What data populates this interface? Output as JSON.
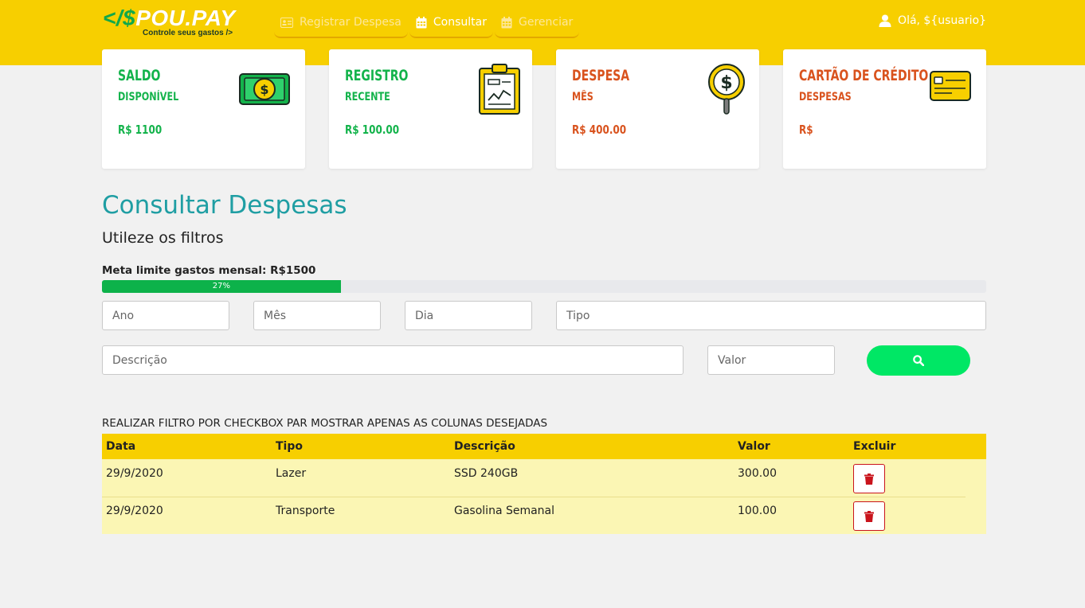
{
  "logo": {
    "code": "</$",
    "name": "POU.PAY",
    "tagline": "Controle seus gastos />"
  },
  "nav": {
    "items": [
      {
        "label": "Registrar Despesa",
        "icon": "id-card-icon"
      },
      {
        "label": "Consultar",
        "icon": "calendar-icon",
        "active": true
      },
      {
        "label": "Gerenciar",
        "icon": "calendar-icon"
      }
    ]
  },
  "user": {
    "greeting": "Olá, ${usuario}",
    "icon": "user-icon"
  },
  "cards": [
    {
      "title": "SALDO",
      "subtitle": "DISPONÍVEL",
      "value": "R$ 1100",
      "icon": "money-bill-icon"
    },
    {
      "title": "REGISTRO",
      "subtitle": "RECENTE",
      "value": "R$ 100.00",
      "icon": "clipboard-chart-icon"
    },
    {
      "title": "DESPESA",
      "subtitle": "MÊS",
      "value": "R$ 400.00",
      "icon": "magnifier-dollar-icon"
    },
    {
      "title": "CARTÃO DE CRÉDITO",
      "subtitle": "DESPESAS",
      "value": "R$",
      "icon": "credit-card-icon"
    }
  ],
  "main": {
    "title": "Consultar Despesas",
    "subtitle": "Utileze os filtros",
    "meta_label": "Meta limite gastos mensal: R$1500",
    "progress_percent": 27,
    "progress_label": "27%"
  },
  "filters": {
    "ano": "Ano",
    "mes": "Mês",
    "dia": "Dia",
    "tipo": "Tipo",
    "descricao": "Descrição",
    "valor": "Valor",
    "search_icon": "search-icon"
  },
  "filter_note": "REALIZAR FILTRO POR CHECKBOX PAR MOSTRAR APENAS AS COLUNAS DESEJADAS",
  "table": {
    "headers": [
      "Data",
      "Tipo",
      "Descrição",
      "Valor",
      "Excluir"
    ],
    "rows": [
      {
        "data": "29/9/2020",
        "tipo": "Lazer",
        "descricao": "SSD 240GB",
        "valor": "300.00"
      },
      {
        "data": "29/9/2020",
        "tipo": "Transporte",
        "descricao": "Gasolina Semanal",
        "valor": "100.00"
      }
    ]
  },
  "colors": {
    "header": "#f7cf00",
    "accent_green": "#13b34b",
    "accent_orange": "#d9531e",
    "title_teal": "#1f9ea3",
    "search_button": "#00e765",
    "row_bg": "#fbf6b4",
    "delete_red": "#c9141c"
  }
}
